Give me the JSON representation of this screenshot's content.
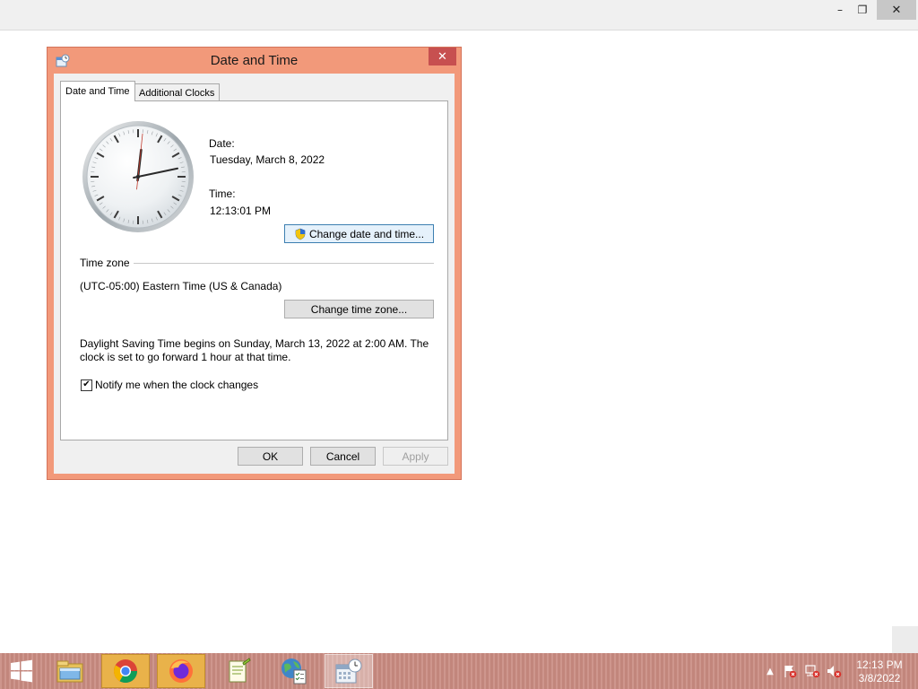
{
  "background_window": {
    "controls": {
      "minimize": "–",
      "maximize": "❐",
      "close": "✕"
    }
  },
  "dialog": {
    "title": "Date and Time",
    "close": "✕",
    "tabs": [
      {
        "label": "Date and Time",
        "active": true
      },
      {
        "label": "Additional Clocks",
        "active": false
      }
    ],
    "clock": {
      "hour": 12,
      "minute": 13,
      "second": 1
    },
    "date_label": "Date:",
    "date_value": "Tuesday, March 8, 2022",
    "time_label": "Time:",
    "time_value": "12:13:01 PM",
    "change_date_time_button": "Change date and time...",
    "time_zone_heading": "Time zone",
    "time_zone_value": "(UTC-05:00) Eastern Time (US & Canada)",
    "change_time_zone_button": "Change time zone...",
    "dst_text": "Daylight Saving Time begins on Sunday, March 13, 2022 at 2:00 AM. The clock is set to go forward 1 hour at that time.",
    "notify": {
      "label": "Notify me when the clock changes",
      "checked": true,
      "check_mark": "✔"
    },
    "buttons": {
      "ok": "OK",
      "cancel": "Cancel",
      "apply": "Apply"
    }
  },
  "taskbar": {
    "items": [
      "file-explorer",
      "chrome",
      "firefox",
      "notepad",
      "network-tool",
      "date-time"
    ],
    "tray": {
      "chevron": "▲",
      "time": "12:13 PM",
      "date": "3/8/2022"
    }
  },
  "colors": {
    "dialog_frame": "#f2997a",
    "close_button": "#c75050",
    "taskbar": "#c88a80",
    "active_taskbar_item": "#e9b24a"
  }
}
